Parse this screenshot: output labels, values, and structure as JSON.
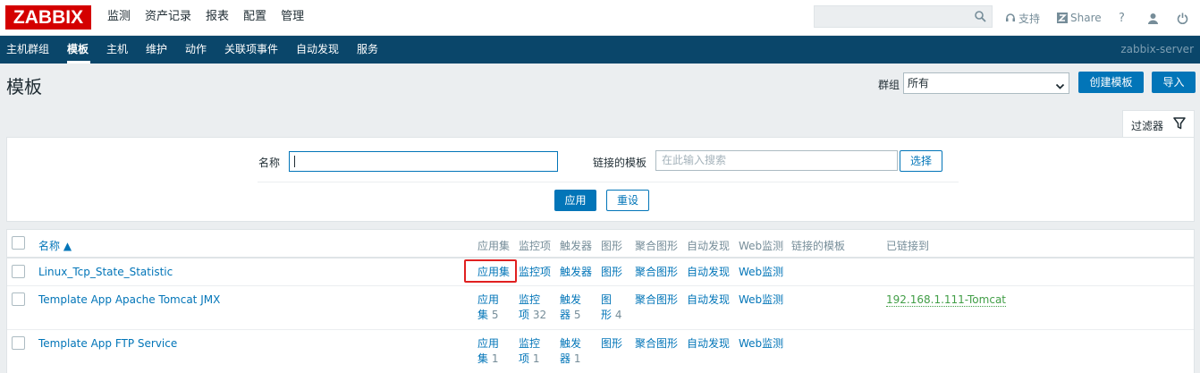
{
  "brand": {
    "logo": "ZABBIX"
  },
  "main_nav": [
    "监测",
    "资产记录",
    "报表",
    "配置",
    "管理"
  ],
  "header_right": {
    "support": "支持",
    "share": "Share",
    "help": "?"
  },
  "sub_nav": {
    "items": [
      "主机群组",
      "模板",
      "主机",
      "维护",
      "动作",
      "关联项事件",
      "自动发现",
      "服务"
    ],
    "active": "模板",
    "server": "zabbix-server"
  },
  "page": {
    "title": "模板",
    "group_label": "群组",
    "group_value": "所有",
    "create_button": "创建模板",
    "import_button": "导入"
  },
  "filter": {
    "tab_label": "过滤器",
    "name_label": "名称",
    "name_value": "",
    "linked_label": "链接的模板",
    "linked_placeholder": "在此输入搜索",
    "select_button": "选择",
    "apply_button": "应用",
    "reset_button": "重设"
  },
  "table": {
    "headers": {
      "name": "名称 ▲",
      "apps": "应用集",
      "items": "监控项",
      "triggers": "触发器",
      "graphs": "图形",
      "screens": "聚合图形",
      "discovery": "自动发现",
      "web": "Web监测",
      "linked_templates": "链接的模板",
      "linked_to": "已链接到"
    },
    "rows": [
      {
        "name": "Linux_Tcp_State_Statistic",
        "apps": "应用集",
        "apps_count": "",
        "items": "监控项",
        "items_count": "",
        "triggers": "触发器",
        "triggers_count": "",
        "graphs": "图形",
        "graphs_count": "",
        "screens": "聚合图形",
        "discovery": "自动发现",
        "web": "Web监测",
        "linked_to": ""
      },
      {
        "name": "Template App Apache Tomcat JMX",
        "apps_l1": "应用",
        "apps_l2": "集",
        "apps_count": "5",
        "items_l1": "监控",
        "items_l2": "项",
        "items_count": "32",
        "triggers_l1": "触发",
        "triggers_l2": "器",
        "triggers_count": "5",
        "graphs_l1": "图",
        "graphs_l2": "形",
        "graphs_count": "4",
        "screens": "聚合图形",
        "discovery": "自动发现",
        "web": "Web监测",
        "linked_to": "192.168.1.111-Tomcat"
      },
      {
        "name": "Template App FTP Service",
        "apps_l1": "应用",
        "apps_l2": "集",
        "apps_count": "1",
        "items_l1": "监控",
        "items_l2": "项",
        "items_count": "1",
        "triggers_l1": "触发",
        "triggers_l2": "器",
        "triggers_count": "1",
        "graphs": "图形",
        "screens": "聚合图形",
        "discovery": "自动发现",
        "web": "Web监测",
        "linked_to": ""
      }
    ]
  },
  "colors": {
    "brand_red": "#d40000",
    "nav_dark": "#0a466a",
    "link_blue": "#0275b8",
    "host_green": "#429e47",
    "highlight_red": "#e02020"
  }
}
